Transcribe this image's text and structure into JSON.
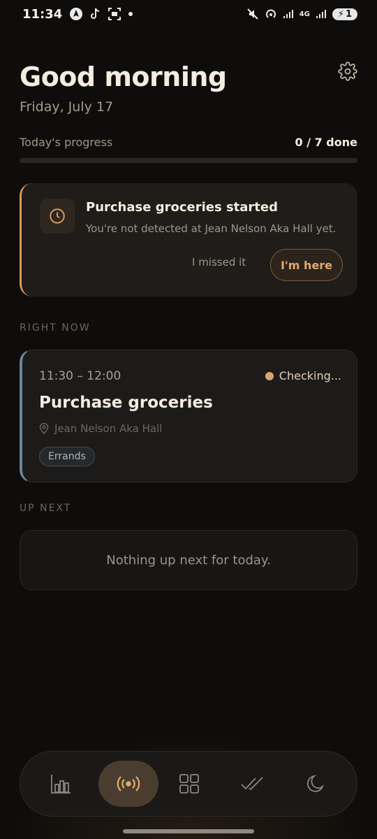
{
  "status_bar": {
    "time": "11:34",
    "battery": "1",
    "network": "4G"
  },
  "header": {
    "greeting": "Good morning",
    "date": "Friday, July 17"
  },
  "progress": {
    "label": "Today's progress",
    "count_text": "0 / 7 done",
    "completed": 0,
    "total": 7
  },
  "alert": {
    "title": "Purchase groceries started",
    "message": "You're not detected at Jean Nelson Aka Hall yet.",
    "missed_label": "I missed it",
    "here_label": "I'm here"
  },
  "right_now": {
    "section_label": "RIGHT NOW",
    "time_range": "11:30 – 12:00",
    "status": "Checking...",
    "title": "Purchase groceries",
    "location": "Jean Nelson Aka Hall",
    "tag": "Errands"
  },
  "up_next": {
    "section_label": "UP NEXT",
    "empty_text": "Nothing up next for today."
  },
  "nav": {
    "items": [
      "stats-icon",
      "broadcast-icon",
      "grid-icon",
      "double-check-icon",
      "moon-icon"
    ],
    "active": "broadcast-icon"
  },
  "colors": {
    "accent": "#d89b5e",
    "background": "#0f0d0b",
    "card": "#1f1c19",
    "task_border": "#6f8497"
  }
}
